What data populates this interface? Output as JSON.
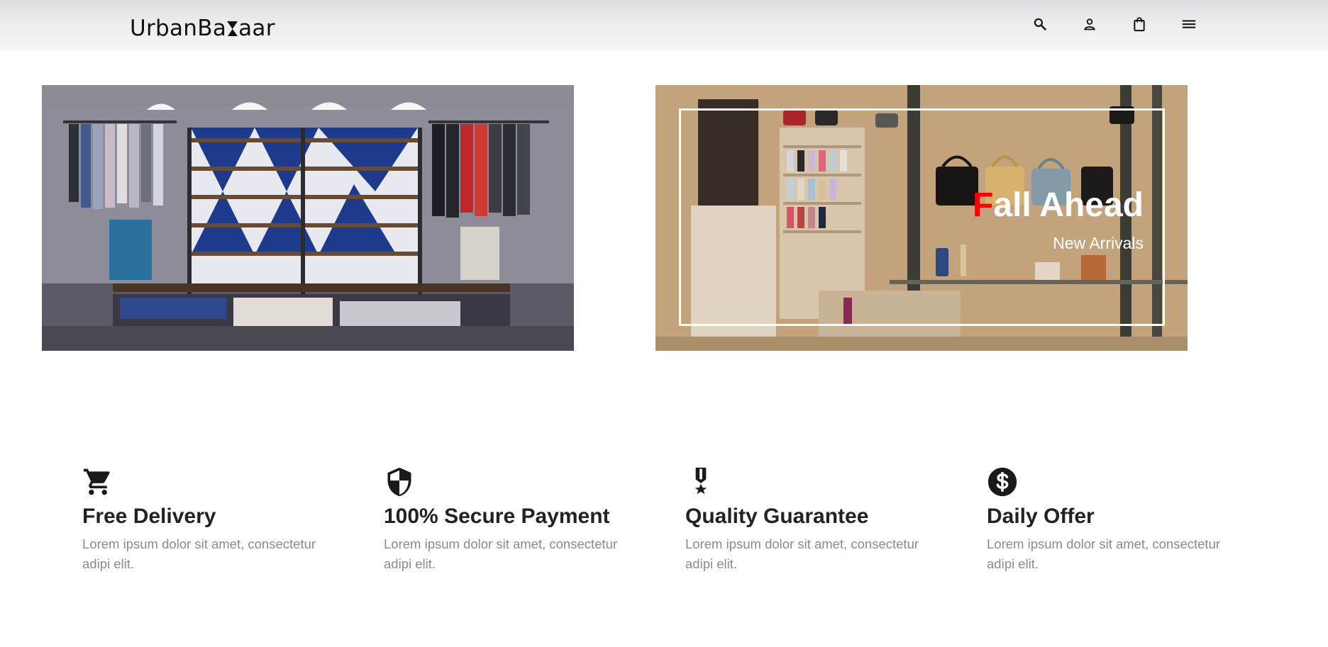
{
  "header": {
    "logo_part1": "UrbanBa",
    "logo_z": "Z",
    "logo_part2": "aar",
    "icons": [
      "search-icon",
      "user-icon",
      "shopping-bag-icon",
      "menu-icon"
    ]
  },
  "banners": {
    "left": {
      "image": "clothing-store-photo"
    },
    "right": {
      "image": "handbag-store-photo",
      "title_first_letter": "F",
      "title_rest": "all Ahead",
      "subtitle": "New Arrivals",
      "accent_color": "#ff0000"
    }
  },
  "features": [
    {
      "icon": "cart-icon",
      "title": "Free Delivery",
      "desc": "Lorem ipsum dolor sit amet, consectetur adipi elit."
    },
    {
      "icon": "shield-icon",
      "title": "100% Secure Payment",
      "desc": "Lorem ipsum dolor sit amet, consectetur adipi elit."
    },
    {
      "icon": "medal-icon",
      "title": "Quality Guarantee",
      "desc": "Lorem ipsum dolor sit amet, consectetur adipi elit."
    },
    {
      "icon": "dollar-icon",
      "title": "Daily Offer",
      "desc": "Lorem ipsum dolor sit amet, consectetur adipi elit."
    }
  ]
}
